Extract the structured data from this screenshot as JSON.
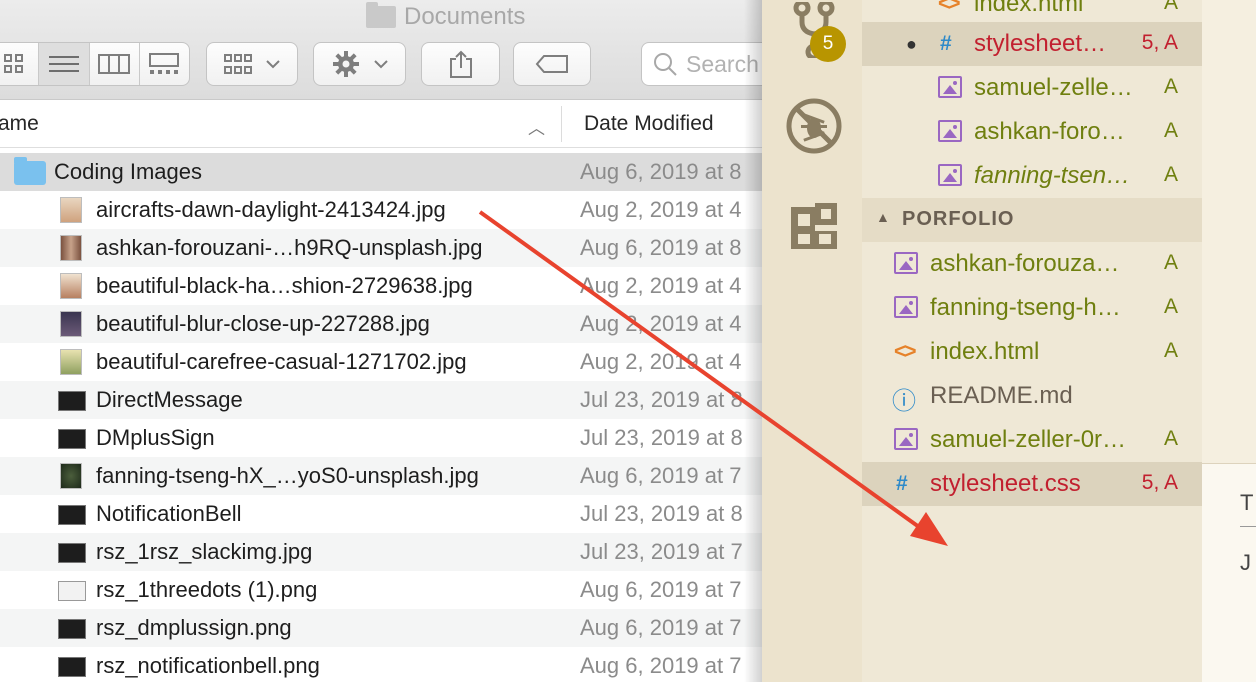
{
  "finder": {
    "title": "Documents",
    "search_placeholder": "Search",
    "columns": {
      "name": "ame",
      "date": "Date Modified"
    },
    "folder_row": {
      "name": "Coding Images",
      "date": "Aug 6, 2019 at 8"
    },
    "files": [
      {
        "name": "aircrafts-dawn-daylight-2413424.jpg",
        "date": "Aug 2, 2019 at 4"
      },
      {
        "name": "ashkan-forouzani-…h9RQ-unsplash.jpg",
        "date": "Aug 6, 2019 at 8"
      },
      {
        "name": "beautiful-black-ha…shion-2729638.jpg",
        "date": "Aug 2, 2019 at 4"
      },
      {
        "name": "beautiful-blur-close-up-227288.jpg",
        "date": "Aug 2, 2019 at 4"
      },
      {
        "name": "beautiful-carefree-casual-1271702.jpg",
        "date": "Aug 2, 2019 at 4"
      },
      {
        "name": "DirectMessage",
        "date": "Jul 23, 2019 at 8"
      },
      {
        "name": "DMplusSign",
        "date": "Jul 23, 2019 at 8"
      },
      {
        "name": "fanning-tseng-hX_…yoS0-unsplash.jpg",
        "date": "Aug 6, 2019 at 7"
      },
      {
        "name": "NotificationBell",
        "date": "Jul 23, 2019 at 8"
      },
      {
        "name": "rsz_1rsz_slackimg.jpg",
        "date": "Jul 23, 2019 at 7"
      },
      {
        "name": "rsz_1threedots (1).png",
        "date": "Aug 6, 2019 at 7"
      },
      {
        "name": "rsz_dmplussign.png",
        "date": "Aug 6, 2019 at 7"
      },
      {
        "name": "rsz_notificationbell.png",
        "date": "Aug 6, 2019 at 7"
      }
    ]
  },
  "vscode": {
    "scm_badge": "5",
    "top_files": [
      {
        "name": "index.html",
        "status": "A",
        "icon": "code-icon"
      },
      {
        "name": "stylesheet…",
        "status": "5, A",
        "icon": "hash-icon"
      },
      {
        "name": "samuel-zelle…",
        "status": "A",
        "icon": "image-icon"
      },
      {
        "name": "ashkan-foro…",
        "status": "A",
        "icon": "image-icon"
      },
      {
        "name": "fanning-tsen…",
        "status": "A",
        "icon": "image-icon"
      }
    ],
    "folder_name": "PORFOLIO",
    "folder_files": [
      {
        "name": "ashkan-forouza…",
        "status": "A",
        "icon": "image-icon"
      },
      {
        "name": "fanning-tseng-h…",
        "status": "A",
        "icon": "image-icon"
      },
      {
        "name": "index.html",
        "status": "A",
        "icon": "code-icon"
      },
      {
        "name": "README.md",
        "status": "",
        "icon": "info-icon"
      },
      {
        "name": "samuel-zeller-0r…",
        "status": "A",
        "icon": "image-icon"
      },
      {
        "name": "stylesheet.css",
        "status": "5, A",
        "icon": "hash-icon"
      }
    ],
    "panel_peek": {
      "line1": "T",
      "line2": "J"
    }
  },
  "colors": {
    "arrow": "#e8432e",
    "added_green": "#6f7f0f",
    "modified_red": "#c2202f",
    "badge": "#b89500"
  }
}
